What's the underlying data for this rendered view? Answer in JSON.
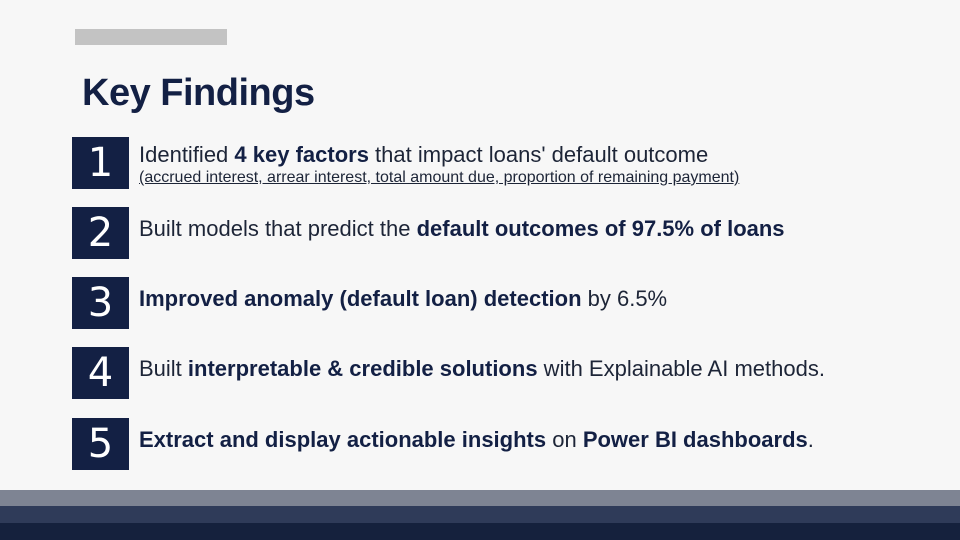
{
  "slide": {
    "title": "Key Findings"
  },
  "findings": [
    {
      "number": "1",
      "parts": [
        "Identified ",
        "4 key factors",
        " that impact loans' default outcome"
      ],
      "sub": "(accrued interest, arrear interest, total amount due, proportion of remaining payment)"
    },
    {
      "number": "2",
      "parts": [
        "Built models that predict the ",
        "default outcomes of 97.5% of loans"
      ]
    },
    {
      "number": "3",
      "parts": [
        "Improved anomaly (default loan) detection",
        " by 6.5%"
      ]
    },
    {
      "number": "4",
      "parts": [
        "Built ",
        "interpretable & credible solutions",
        " with Explainable AI methods."
      ]
    },
    {
      "number": "5",
      "parts": [
        "Extract and display actionable insights",
        " on ",
        "Power BI dashboards",
        "."
      ]
    }
  ],
  "colors": {
    "navy": "#132044",
    "background": "#f7f7f7",
    "accent_bar": "#c3c3c3"
  }
}
